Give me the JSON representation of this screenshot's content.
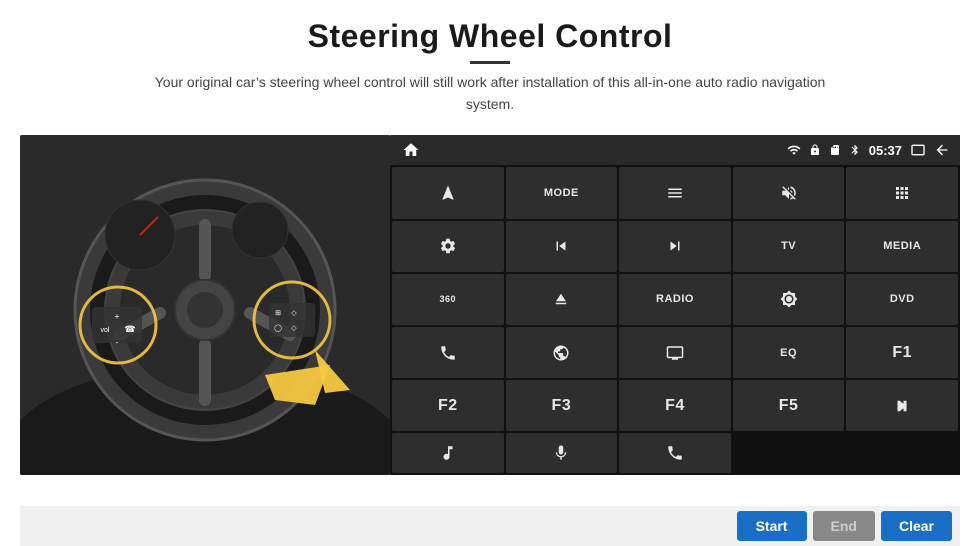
{
  "header": {
    "title": "Steering Wheel Control",
    "divider": true,
    "subtitle": "Your original car’s steering wheel control will still work after installation of this all-in-one auto radio navigation system."
  },
  "status_bar": {
    "time": "05:37",
    "wifi_icon": "wifi",
    "lock_icon": "lock",
    "sd_icon": "sd",
    "bluetooth_icon": "bluetooth",
    "window_icon": "window",
    "back_icon": "back"
  },
  "control_buttons": [
    {
      "id": "btn-nav",
      "label": "",
      "icon": "navigate"
    },
    {
      "id": "btn-mode",
      "label": "MODE",
      "icon": ""
    },
    {
      "id": "btn-menu",
      "label": "",
      "icon": "menu"
    },
    {
      "id": "btn-volmute",
      "label": "",
      "icon": "vol-mute"
    },
    {
      "id": "btn-apps",
      "label": "",
      "icon": "apps"
    },
    {
      "id": "btn-settings",
      "label": "",
      "icon": "settings"
    },
    {
      "id": "btn-prev",
      "label": "",
      "icon": "skip-prev"
    },
    {
      "id": "btn-next",
      "label": "",
      "icon": "skip-next"
    },
    {
      "id": "btn-tv",
      "label": "TV",
      "icon": ""
    },
    {
      "id": "btn-media",
      "label": "MEDIA",
      "icon": ""
    },
    {
      "id": "btn-360",
      "label": "",
      "icon": "camera-360"
    },
    {
      "id": "btn-eject",
      "label": "",
      "icon": "eject"
    },
    {
      "id": "btn-radio",
      "label": "RADIO",
      "icon": ""
    },
    {
      "id": "btn-bright",
      "label": "",
      "icon": "brightness"
    },
    {
      "id": "btn-dvd",
      "label": "DVD",
      "icon": ""
    },
    {
      "id": "btn-phone",
      "label": "",
      "icon": "phone"
    },
    {
      "id": "btn-web",
      "label": "",
      "icon": "web"
    },
    {
      "id": "btn-screen",
      "label": "",
      "icon": "screen"
    },
    {
      "id": "btn-eq",
      "label": "EQ",
      "icon": ""
    },
    {
      "id": "btn-f1",
      "label": "F1",
      "icon": ""
    },
    {
      "id": "btn-f2",
      "label": "F2",
      "icon": ""
    },
    {
      "id": "btn-f3",
      "label": "F3",
      "icon": ""
    },
    {
      "id": "btn-f4",
      "label": "F4",
      "icon": ""
    },
    {
      "id": "btn-f5",
      "label": "F5",
      "icon": ""
    },
    {
      "id": "btn-playpause",
      "label": "",
      "icon": "play-pause"
    },
    {
      "id": "btn-music",
      "label": "",
      "icon": "music"
    },
    {
      "id": "btn-mic",
      "label": "",
      "icon": "microphone"
    },
    {
      "id": "btn-call",
      "label": "",
      "icon": "call"
    }
  ],
  "bottom_bar": {
    "start_label": "Start",
    "end_label": "End",
    "clear_label": "Clear"
  }
}
